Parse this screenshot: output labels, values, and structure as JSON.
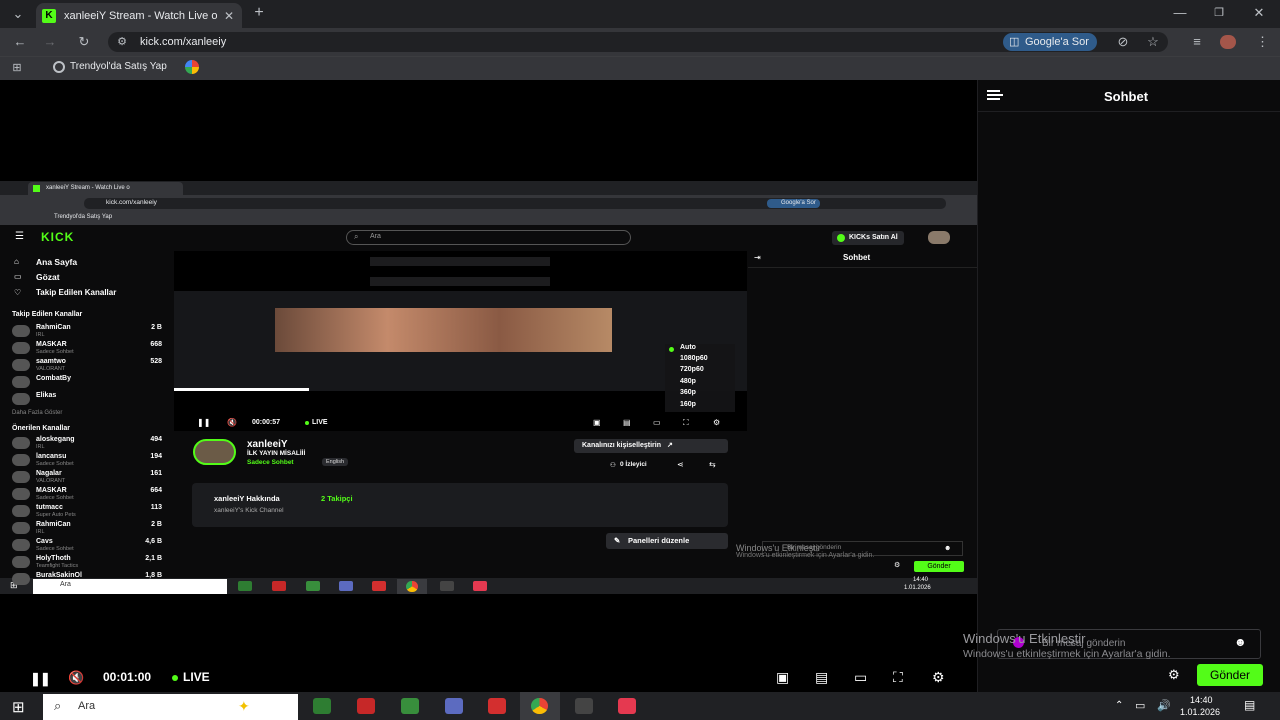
{
  "browser": {
    "tab_title": "xanleeiY Stream - Watch Live o",
    "url": "kick.com/xanleeiy",
    "google_ask": "Google'a Sor",
    "bookmark": "Trendyol'da Satış Yap"
  },
  "chat": {
    "title": "Sohbet",
    "placeholder": "Bir mesaj gönderin",
    "send": "Gönder"
  },
  "player": {
    "time": "00:01:00",
    "live": "LIVE"
  },
  "windows_activation": {
    "title": "Windows'u Etkinleştir",
    "subtitle": "Windows'u etkinleştirmek için Ayarlar'a gidin."
  },
  "taskbar": {
    "search": "Ara",
    "time": "14:40",
    "date": "1.01.2026"
  },
  "nested": {
    "tab_title": "xanleeiY Stream - Watch Live o",
    "url": "kick.com/xanleeiy",
    "google_ask": "Google'a Sor",
    "bookmark": "Trendyol'da Satış Yap",
    "logo": "KICK",
    "search_placeholder": "Ara",
    "kicks_button": "KICKs Satın Al",
    "nav": [
      "Ana Sayfa",
      "Gözat",
      "Takip Edilen Kanallar"
    ],
    "followed_title": "Takip Edilen Kanallar",
    "followed": [
      {
        "name": "RahmiCan",
        "sub": "IRL",
        "viewers": "2 B"
      },
      {
        "name": "MASKAR",
        "sub": "Sadece Sohbet",
        "viewers": "668"
      },
      {
        "name": "saamtwo",
        "sub": "VALORANT",
        "viewers": "528"
      },
      {
        "name": "CombatBy",
        "sub": "",
        "viewers": ""
      },
      {
        "name": "Elikas",
        "sub": "",
        "viewers": ""
      }
    ],
    "show_more": "Daha Fazla Göster",
    "recommended_title": "Önerilen Kanallar",
    "recommended": [
      {
        "name": "aloskegang",
        "sub": "IRL",
        "viewers": "494"
      },
      {
        "name": "lancansu",
        "sub": "Sadece Sohbet",
        "viewers": "194"
      },
      {
        "name": "Nagalar",
        "sub": "VALORANT",
        "viewers": "161"
      },
      {
        "name": "MASKAR",
        "sub": "Sadece Sohbet",
        "viewers": "664"
      },
      {
        "name": "tutmacc",
        "sub": "Super Auto Pets",
        "viewers": "113"
      },
      {
        "name": "RahmiCan",
        "sub": "IRL",
        "viewers": "2 B"
      },
      {
        "name": "Cavs",
        "sub": "Sadece Sohbet",
        "viewers": "4,6 B"
      },
      {
        "name": "HolyThoth",
        "sub": "Teamfight Tactics",
        "viewers": "2,1 B"
      },
      {
        "name": "BurakSakinOl",
        "sub": "",
        "viewers": "1,8 B"
      }
    ],
    "quality": [
      "Auto",
      "1080p60",
      "720p60",
      "480p",
      "360p",
      "160p"
    ],
    "time": "00:00:57",
    "live": "LIVE",
    "channel_name": "xanleeiY",
    "stream_title": "İLK YAYIN MİSALİİİ",
    "category": "Sadece Sohbet",
    "language": "English",
    "customize": "Kanalınızı kişiselleştirin",
    "viewers": "0 İzleyici",
    "about_title": "xanleeiY Hakkında",
    "followers": "2 Takipçi",
    "about_desc": "xanleeiY's Kick Channel",
    "edit_panels": "Panelleri düzenle",
    "chat_title": "Sohbet",
    "chat_placeholder": "Bir mesaj gönderin",
    "send": "Gönder",
    "activation_title": "Windows'u Etkinleştir",
    "activation_sub": "Windows'u etkinleştirmek için Ayarlar'a gidin.",
    "taskbar_search": "Ara",
    "taskbar_time": "14:40",
    "taskbar_date": "1.01.2026"
  },
  "colors": {
    "accent": "#53fc18",
    "background": "#000000",
    "chrome": "#35363a"
  }
}
